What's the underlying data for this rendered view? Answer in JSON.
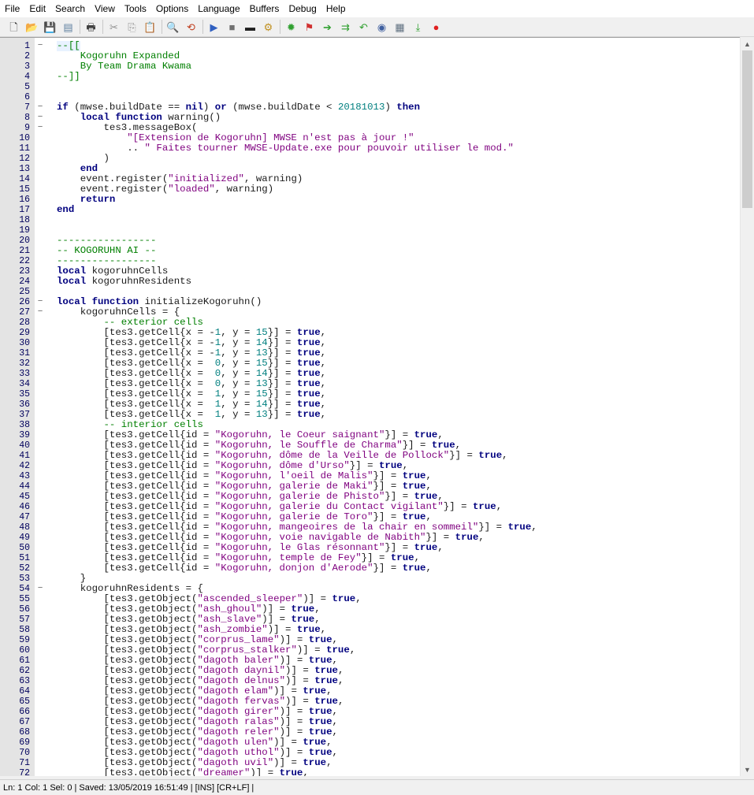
{
  "menu": [
    "File",
    "Edit",
    "Search",
    "View",
    "Tools",
    "Options",
    "Language",
    "Buffers",
    "Debug",
    "Help"
  ],
  "toolbar": {
    "groups": [
      [
        "new-file-icon",
        "open-file-icon",
        "save-icon",
        "save-all-icon"
      ],
      [
        "print-icon"
      ],
      [
        "cut-icon",
        "copy-icon",
        "paste-icon"
      ],
      [
        "find-icon",
        "replace-icon"
      ],
      [
        "run-icon",
        "stop-icon",
        "terminal-icon",
        "build-icon"
      ],
      [
        "settings-icon",
        "bookmark-icon",
        "go-icon",
        "next-icon",
        "prev-icon",
        "view-icon",
        "list-icon",
        "export-icon",
        "record-icon"
      ]
    ],
    "glyphs": {
      "new-file-icon": "🗋",
      "open-file-icon": "📂",
      "save-icon": "💾",
      "save-all-icon": "▤",
      "print-icon": "🖶",
      "cut-icon": "✂",
      "copy-icon": "⎘",
      "paste-icon": "📋",
      "find-icon": "🔍",
      "replace-icon": "⟲",
      "run-icon": "▶",
      "stop-icon": "■",
      "terminal-icon": "▬",
      "build-icon": "⚙",
      "settings-icon": "✹",
      "bookmark-icon": "⚑",
      "go-icon": "➔",
      "next-icon": "⇉",
      "prev-icon": "↶",
      "view-icon": "◉",
      "list-icon": "▦",
      "export-icon": "⤓",
      "record-icon": "●"
    },
    "colors": {
      "new-file-icon": "#333",
      "open-file-icon": "#c8a020",
      "save-icon": "#5070a0",
      "save-all-icon": "#6080a0",
      "print-icon": "#404040",
      "cut-icon": "#909090",
      "copy-icon": "#909090",
      "paste-icon": "#806030",
      "find-icon": "#205080",
      "replace-icon": "#c04020",
      "run-icon": "#3060c0",
      "stop-icon": "#707070",
      "terminal-icon": "#202020",
      "build-icon": "#c09020",
      "settings-icon": "#30a030",
      "bookmark-icon": "#d03030",
      "go-icon": "#30a030",
      "next-icon": "#30a030",
      "prev-icon": "#30a030",
      "view-icon": "#4060a0",
      "list-icon": "#607080",
      "export-icon": "#30a030",
      "record-icon": "#e02020"
    }
  },
  "editor": {
    "lines": [
      [
        [
          "--[[",
          "c-com"
        ]
      ],
      [
        [
          "    Kogoruhn Expanded",
          "c-com"
        ]
      ],
      [
        [
          "    By Team Drama Kwama",
          "c-com"
        ]
      ],
      [
        [
          "--]]",
          "c-com"
        ]
      ],
      [],
      [],
      [
        [
          "if",
          "c-kw"
        ],
        [
          " (mwse.buildDate == "
        ],
        [
          "nil",
          "c-kw"
        ],
        [
          ") "
        ],
        [
          "or",
          "c-kw"
        ],
        [
          " (mwse.buildDate < "
        ],
        [
          "20181013",
          "c-num"
        ],
        [
          ") "
        ],
        [
          "then",
          "c-kw"
        ]
      ],
      [
        [
          "    "
        ],
        [
          "local",
          "c-kw"
        ],
        [
          " "
        ],
        [
          "function",
          "c-kw"
        ],
        [
          " warning()"
        ]
      ],
      [
        [
          "        tes3.messageBox("
        ]
      ],
      [
        [
          "            "
        ],
        [
          "\"[Extension de Kogoruhn] MWSE n'est pas à jour !\"",
          "c-str"
        ]
      ],
      [
        [
          "            .. "
        ],
        [
          "\" Faites tourner MWSE-Update.exe pour pouvoir utiliser le mod.\"",
          "c-str"
        ]
      ],
      [
        [
          "        )"
        ]
      ],
      [
        [
          "    "
        ],
        [
          "end",
          "c-kw"
        ]
      ],
      [
        [
          "    event.register("
        ],
        [
          "\"initialized\"",
          "c-str"
        ],
        [
          ", warning)"
        ]
      ],
      [
        [
          "    event.register("
        ],
        [
          "\"loaded\"",
          "c-str"
        ],
        [
          ", warning)"
        ]
      ],
      [
        [
          "    "
        ],
        [
          "return",
          "c-kw"
        ]
      ],
      [
        [
          "end",
          "c-kw"
        ]
      ],
      [],
      [],
      [
        [
          "-----------------",
          "c-com"
        ]
      ],
      [
        [
          "-- KOGORUHN AI --",
          "c-com"
        ]
      ],
      [
        [
          "-----------------",
          "c-com"
        ]
      ],
      [
        [
          "local",
          "c-kw"
        ],
        [
          " kogoruhnCells"
        ]
      ],
      [
        [
          "local",
          "c-kw"
        ],
        [
          " kogoruhnResidents"
        ]
      ],
      [],
      [
        [
          "local",
          "c-kw"
        ],
        [
          " "
        ],
        [
          "function",
          "c-kw"
        ],
        [
          " initializeKogoruhn()"
        ]
      ],
      [
        [
          "    kogoruhnCells = {"
        ]
      ],
      [
        [
          "        "
        ],
        [
          "-- exterior cells",
          "c-com"
        ]
      ],
      [
        [
          "        [tes3.getCell{x = -"
        ],
        [
          "1",
          "c-num"
        ],
        [
          ", y = "
        ],
        [
          "15",
          "c-num"
        ],
        [
          "}] = "
        ],
        [
          "true",
          "c-kw"
        ],
        [
          ","
        ]
      ],
      [
        [
          "        [tes3.getCell{x = -"
        ],
        [
          "1",
          "c-num"
        ],
        [
          ", y = "
        ],
        [
          "14",
          "c-num"
        ],
        [
          "}] = "
        ],
        [
          "true",
          "c-kw"
        ],
        [
          ","
        ]
      ],
      [
        [
          "        [tes3.getCell{x = -"
        ],
        [
          "1",
          "c-num"
        ],
        [
          ", y = "
        ],
        [
          "13",
          "c-num"
        ],
        [
          "}] = "
        ],
        [
          "true",
          "c-kw"
        ],
        [
          ","
        ]
      ],
      [
        [
          "        [tes3.getCell{x =  "
        ],
        [
          "0",
          "c-num"
        ],
        [
          ", y = "
        ],
        [
          "15",
          "c-num"
        ],
        [
          "}] = "
        ],
        [
          "true",
          "c-kw"
        ],
        [
          ","
        ]
      ],
      [
        [
          "        [tes3.getCell{x =  "
        ],
        [
          "0",
          "c-num"
        ],
        [
          ", y = "
        ],
        [
          "14",
          "c-num"
        ],
        [
          "}] = "
        ],
        [
          "true",
          "c-kw"
        ],
        [
          ","
        ]
      ],
      [
        [
          "        [tes3.getCell{x =  "
        ],
        [
          "0",
          "c-num"
        ],
        [
          ", y = "
        ],
        [
          "13",
          "c-num"
        ],
        [
          "}] = "
        ],
        [
          "true",
          "c-kw"
        ],
        [
          ","
        ]
      ],
      [
        [
          "        [tes3.getCell{x =  "
        ],
        [
          "1",
          "c-num"
        ],
        [
          ", y = "
        ],
        [
          "15",
          "c-num"
        ],
        [
          "}] = "
        ],
        [
          "true",
          "c-kw"
        ],
        [
          ","
        ]
      ],
      [
        [
          "        [tes3.getCell{x =  "
        ],
        [
          "1",
          "c-num"
        ],
        [
          ", y = "
        ],
        [
          "14",
          "c-num"
        ],
        [
          "}] = "
        ],
        [
          "true",
          "c-kw"
        ],
        [
          ","
        ]
      ],
      [
        [
          "        [tes3.getCell{x =  "
        ],
        [
          "1",
          "c-num"
        ],
        [
          ", y = "
        ],
        [
          "13",
          "c-num"
        ],
        [
          "}] = "
        ],
        [
          "true",
          "c-kw"
        ],
        [
          ","
        ]
      ],
      [
        [
          "        "
        ],
        [
          "-- interior cells",
          "c-com"
        ]
      ],
      [
        [
          "        [tes3.getCell{id = "
        ],
        [
          "\"Kogoruhn, le Coeur saignant\"",
          "c-str"
        ],
        [
          "}] = "
        ],
        [
          "true",
          "c-kw"
        ],
        [
          ","
        ]
      ],
      [
        [
          "        [tes3.getCell{id = "
        ],
        [
          "\"Kogoruhn, le Souffle de Charma\"",
          "c-str"
        ],
        [
          "}] = "
        ],
        [
          "true",
          "c-kw"
        ],
        [
          ","
        ]
      ],
      [
        [
          "        [tes3.getCell{id = "
        ],
        [
          "\"Kogoruhn, dôme de la Veille de Pollock\"",
          "c-str"
        ],
        [
          "}] = "
        ],
        [
          "true",
          "c-kw"
        ],
        [
          ","
        ]
      ],
      [
        [
          "        [tes3.getCell{id = "
        ],
        [
          "\"Kogoruhn, dôme d'Urso\"",
          "c-str"
        ],
        [
          "}] = "
        ],
        [
          "true",
          "c-kw"
        ],
        [
          ","
        ]
      ],
      [
        [
          "        [tes3.getCell{id = "
        ],
        [
          "\"Kogoruhn, l'oeil de Malis\"",
          "c-str"
        ],
        [
          "}] = "
        ],
        [
          "true",
          "c-kw"
        ],
        [
          ","
        ]
      ],
      [
        [
          "        [tes3.getCell{id = "
        ],
        [
          "\"Kogoruhn, galerie de Maki\"",
          "c-str"
        ],
        [
          "}] = "
        ],
        [
          "true",
          "c-kw"
        ],
        [
          ","
        ]
      ],
      [
        [
          "        [tes3.getCell{id = "
        ],
        [
          "\"Kogoruhn, galerie de Phisto\"",
          "c-str"
        ],
        [
          "}] = "
        ],
        [
          "true",
          "c-kw"
        ],
        [
          ","
        ]
      ],
      [
        [
          "        [tes3.getCell{id = "
        ],
        [
          "\"Kogoruhn, galerie du Contact vigilant\"",
          "c-str"
        ],
        [
          "}] = "
        ],
        [
          "true",
          "c-kw"
        ],
        [
          ","
        ]
      ],
      [
        [
          "        [tes3.getCell{id = "
        ],
        [
          "\"Kogoruhn, galerie de Toro\"",
          "c-str"
        ],
        [
          "}] = "
        ],
        [
          "true",
          "c-kw"
        ],
        [
          ","
        ]
      ],
      [
        [
          "        [tes3.getCell{id = "
        ],
        [
          "\"Kogoruhn, mangeoires de la chair en sommeil\"",
          "c-str"
        ],
        [
          "}] = "
        ],
        [
          "true",
          "c-kw"
        ],
        [
          ","
        ]
      ],
      [
        [
          "        [tes3.getCell{id = "
        ],
        [
          "\"Kogoruhn, voie navigable de Nabith\"",
          "c-str"
        ],
        [
          "}] = "
        ],
        [
          "true",
          "c-kw"
        ],
        [
          ","
        ]
      ],
      [
        [
          "        [tes3.getCell{id = "
        ],
        [
          "\"Kogoruhn, le Glas résonnant\"",
          "c-str"
        ],
        [
          "}] = "
        ],
        [
          "true",
          "c-kw"
        ],
        [
          ","
        ]
      ],
      [
        [
          "        [tes3.getCell{id = "
        ],
        [
          "\"Kogoruhn, temple de Fey\"",
          "c-str"
        ],
        [
          "}] = "
        ],
        [
          "true",
          "c-kw"
        ],
        [
          ","
        ]
      ],
      [
        [
          "        [tes3.getCell{id = "
        ],
        [
          "\"Kogoruhn, donjon d'Aerode\"",
          "c-str"
        ],
        [
          "}] = "
        ],
        [
          "true",
          "c-kw"
        ],
        [
          ","
        ]
      ],
      [
        [
          "    }"
        ]
      ],
      [
        [
          "    kogoruhnResidents = {"
        ]
      ],
      [
        [
          "        [tes3.getObject("
        ],
        [
          "\"ascended_sleeper\"",
          "c-str"
        ],
        [
          ")] = "
        ],
        [
          "true",
          "c-kw"
        ],
        [
          ","
        ]
      ],
      [
        [
          "        [tes3.getObject("
        ],
        [
          "\"ash_ghoul\"",
          "c-str"
        ],
        [
          ")] = "
        ],
        [
          "true",
          "c-kw"
        ],
        [
          ","
        ]
      ],
      [
        [
          "        [tes3.getObject("
        ],
        [
          "\"ash_slave\"",
          "c-str"
        ],
        [
          ")] = "
        ],
        [
          "true",
          "c-kw"
        ],
        [
          ","
        ]
      ],
      [
        [
          "        [tes3.getObject("
        ],
        [
          "\"ash_zombie\"",
          "c-str"
        ],
        [
          ")] = "
        ],
        [
          "true",
          "c-kw"
        ],
        [
          ","
        ]
      ],
      [
        [
          "        [tes3.getObject("
        ],
        [
          "\"corprus_lame\"",
          "c-str"
        ],
        [
          ")] = "
        ],
        [
          "true",
          "c-kw"
        ],
        [
          ","
        ]
      ],
      [
        [
          "        [tes3.getObject("
        ],
        [
          "\"corprus_stalker\"",
          "c-str"
        ],
        [
          ")] = "
        ],
        [
          "true",
          "c-kw"
        ],
        [
          ","
        ]
      ],
      [
        [
          "        [tes3.getObject("
        ],
        [
          "\"dagoth baler\"",
          "c-str"
        ],
        [
          ")] = "
        ],
        [
          "true",
          "c-kw"
        ],
        [
          ","
        ]
      ],
      [
        [
          "        [tes3.getObject("
        ],
        [
          "\"dagoth daynil\"",
          "c-str"
        ],
        [
          ")] = "
        ],
        [
          "true",
          "c-kw"
        ],
        [
          ","
        ]
      ],
      [
        [
          "        [tes3.getObject("
        ],
        [
          "\"dagoth delnus\"",
          "c-str"
        ],
        [
          ")] = "
        ],
        [
          "true",
          "c-kw"
        ],
        [
          ","
        ]
      ],
      [
        [
          "        [tes3.getObject("
        ],
        [
          "\"dagoth elam\"",
          "c-str"
        ],
        [
          ")] = "
        ],
        [
          "true",
          "c-kw"
        ],
        [
          ","
        ]
      ],
      [
        [
          "        [tes3.getObject("
        ],
        [
          "\"dagoth fervas\"",
          "c-str"
        ],
        [
          ")] = "
        ],
        [
          "true",
          "c-kw"
        ],
        [
          ","
        ]
      ],
      [
        [
          "        [tes3.getObject("
        ],
        [
          "\"dagoth girer\"",
          "c-str"
        ],
        [
          ")] = "
        ],
        [
          "true",
          "c-kw"
        ],
        [
          ","
        ]
      ],
      [
        [
          "        [tes3.getObject("
        ],
        [
          "\"dagoth ralas\"",
          "c-str"
        ],
        [
          ")] = "
        ],
        [
          "true",
          "c-kw"
        ],
        [
          ","
        ]
      ],
      [
        [
          "        [tes3.getObject("
        ],
        [
          "\"dagoth reler\"",
          "c-str"
        ],
        [
          ")] = "
        ],
        [
          "true",
          "c-kw"
        ],
        [
          ","
        ]
      ],
      [
        [
          "        [tes3.getObject("
        ],
        [
          "\"dagoth ulen\"",
          "c-str"
        ],
        [
          ")] = "
        ],
        [
          "true",
          "c-kw"
        ],
        [
          ","
        ]
      ],
      [
        [
          "        [tes3.getObject("
        ],
        [
          "\"dagoth uthol\"",
          "c-str"
        ],
        [
          ")] = "
        ],
        [
          "true",
          "c-kw"
        ],
        [
          ","
        ]
      ],
      [
        [
          "        [tes3.getObject("
        ],
        [
          "\"dagoth uvil\"",
          "c-str"
        ],
        [
          ")] = "
        ],
        [
          "true",
          "c-kw"
        ],
        [
          ","
        ]
      ],
      [
        [
          "        [tes3.getObject("
        ],
        [
          "\"dreamer\"",
          "c-str"
        ],
        [
          ")] = "
        ],
        [
          "true",
          "c-kw"
        ],
        [
          ","
        ]
      ]
    ],
    "fold_markers": {
      "1": "−",
      "7": "−",
      "8": "−",
      "9": "−",
      "26": "−",
      "27": "−",
      "54": "−"
    }
  },
  "scrollbar": {
    "up_arrow": "▲",
    "down_arrow": "▼"
  },
  "status": "Ln: 1 Col: 1 Sel: 0  |  Saved: 13/05/2019  16:51:49  |  [INS]  [CR+LF]  |"
}
